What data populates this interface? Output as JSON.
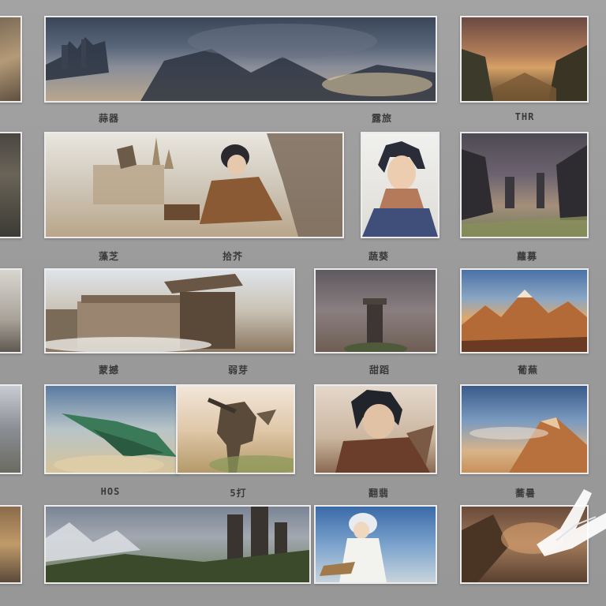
{
  "captions": {
    "r1c2": "蒜器",
    "r1c3": "露旅",
    "r1c4": "THR",
    "r2c2a": "藻芝",
    "r2c2b": "拾芥",
    "r2c3": "蔬葵",
    "r2c4": "蘿募",
    "r3c2a": "蒙撼",
    "r3c2b": "弱芽",
    "r3c3": "甜蹈",
    "r3c4": "葡蕪",
    "r4c2a": "HOS",
    "r4c2b": "5打",
    "r4c3": "翻翡",
    "r4c4": "蕎暑"
  },
  "tiles": [
    "edge-cliff-left-1",
    "ruined-castle-storm-panorama",
    "canyon-sunset",
    "edge-tree-left-2",
    "hero-castle-scene",
    "hero-portrait",
    "dark-ruins-valley",
    "edge-tower-left-3",
    "sky-palace-panorama",
    "lone-tower-dusk",
    "golden-mountains",
    "edge-spire-left-4",
    "green-dragon",
    "armored-knight",
    "cloaked-boy",
    "sunlit-peak",
    "edge-ruins-left-5",
    "mountain-fortress",
    "white-robed-girl",
    "autumn-cliffs"
  ]
}
